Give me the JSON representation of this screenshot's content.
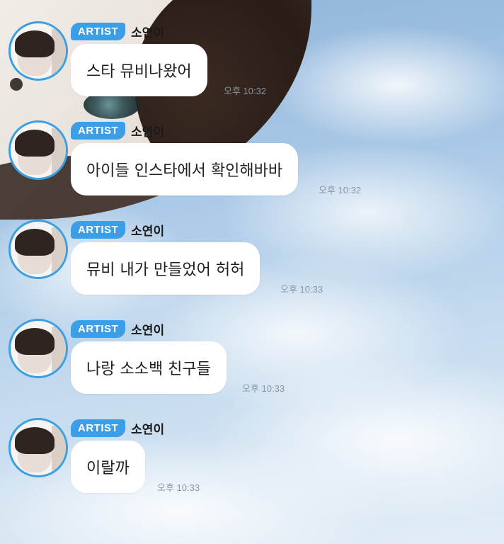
{
  "chat": {
    "messages": [
      {
        "badge": "ARTIST",
        "sender": "소연이",
        "text": "스타 뮤비나왔어",
        "time": "오후 10:32"
      },
      {
        "badge": "ARTIST",
        "sender": "소연이",
        "text": "아이들 인스타에서 확인해바바",
        "time": "오후 10:32"
      },
      {
        "badge": "ARTIST",
        "sender": "소연이",
        "text": "뮤비 내가 만들었어 허허",
        "time": "오후 10:33"
      },
      {
        "badge": "ARTIST",
        "sender": "소연이",
        "text": "나랑 소소백 친구들",
        "time": "오후 10:33"
      },
      {
        "badge": "ARTIST",
        "sender": "소연이",
        "text": "이랄까",
        "time": "오후 10:33"
      }
    ]
  },
  "colors": {
    "badge": "#3b9ee6",
    "avatar_ring": "#3aa0e6",
    "bubble": "#ffffff",
    "time": "#8a96a4"
  }
}
